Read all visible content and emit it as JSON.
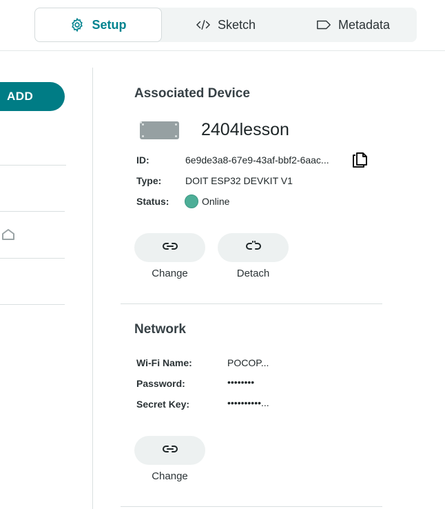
{
  "tabs": [
    {
      "label": "Setup",
      "icon": "gear-icon",
      "active": true
    },
    {
      "label": "Sketch",
      "icon": "code-icon",
      "active": false
    },
    {
      "label": "Metadata",
      "icon": "tag-icon",
      "active": false
    }
  ],
  "sidebar": {
    "add_label": "ADD",
    "home_icon": "home-icon"
  },
  "device": {
    "section_title": "Associated Device",
    "name": "2404lesson",
    "id_label": "ID:",
    "id_value": "6e9de3a8-67e9-43af-bbf2-6aac...",
    "type_label": "Type:",
    "type_value": "DOIT ESP32 DEVKIT V1",
    "status_label": "Status:",
    "status_value": "Online",
    "status_color": "#4dae97",
    "change_label": "Change",
    "detach_label": "Detach"
  },
  "network": {
    "section_title": "Network",
    "wifi_label": "Wi-Fi Name:",
    "wifi_value": "POCOP...",
    "password_label": "Password:",
    "password_value": "••••••••",
    "secret_label": "Secret Key:",
    "secret_value": "••••••••••...",
    "change_label": "Change"
  },
  "colors": {
    "accent": "#00838f",
    "add_button": "#007c85"
  }
}
